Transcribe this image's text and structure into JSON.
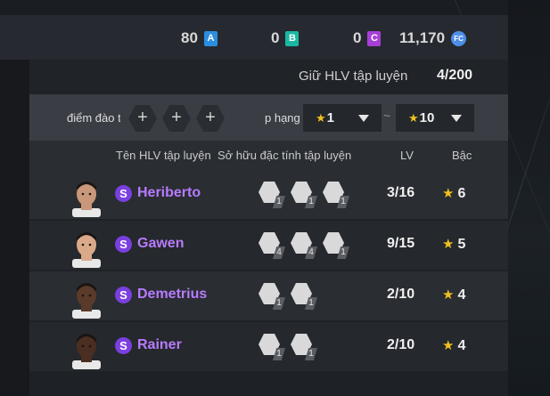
{
  "currency": {
    "a": {
      "value": "80",
      "token": "A"
    },
    "b": {
      "value": "0",
      "token": "B"
    },
    "c": {
      "value": "0",
      "token": "C"
    },
    "fc": {
      "value": "11,170",
      "token": "FC"
    }
  },
  "keep": {
    "label": "Giữ HLV tập luyện",
    "value": "4/200"
  },
  "filter": {
    "label": "điểm đào t",
    "slots": [
      "+",
      "+",
      "+"
    ],
    "rank_label": "p hạng",
    "separator": "~",
    "min": "1",
    "max": "10"
  },
  "headers": {
    "name": "Tên HLV tập luyện",
    "traits": "Sở hữu đặc tính tập luyện",
    "lv": "LV",
    "tier": "Bậc"
  },
  "rows": [
    {
      "badge": "S",
      "name": "Heriberto",
      "lv": "3/16",
      "tier": "6",
      "traits": [
        "1",
        "1",
        "1"
      ],
      "trait_icons": [
        "shield-tackle-icon",
        "shield-shot-icon",
        "shield-sprint-icon"
      ]
    },
    {
      "badge": "S",
      "name": "Gawen",
      "lv": "9/15",
      "tier": "5",
      "traits": [
        "4",
        "4",
        "1"
      ],
      "trait_icons": [
        "shield-tackle-icon",
        "shield-jump-icon",
        "shield-sprint-icon"
      ]
    },
    {
      "badge": "S",
      "name": "Demetrius",
      "lv": "2/10",
      "tier": "4",
      "traits": [
        "1",
        "1"
      ],
      "trait_icons": [
        "shield-dribble-icon",
        "shield-strength-icon"
      ]
    },
    {
      "badge": "S",
      "name": "Rainer",
      "lv": "2/10",
      "tier": "4",
      "traits": [
        "1",
        "1"
      ],
      "trait_icons": [
        "tower-icon",
        "shield-shot-icon"
      ]
    }
  ],
  "colors": {
    "name": "#b77bff",
    "badge": "#7a3fe0",
    "star": "#f0c020"
  }
}
